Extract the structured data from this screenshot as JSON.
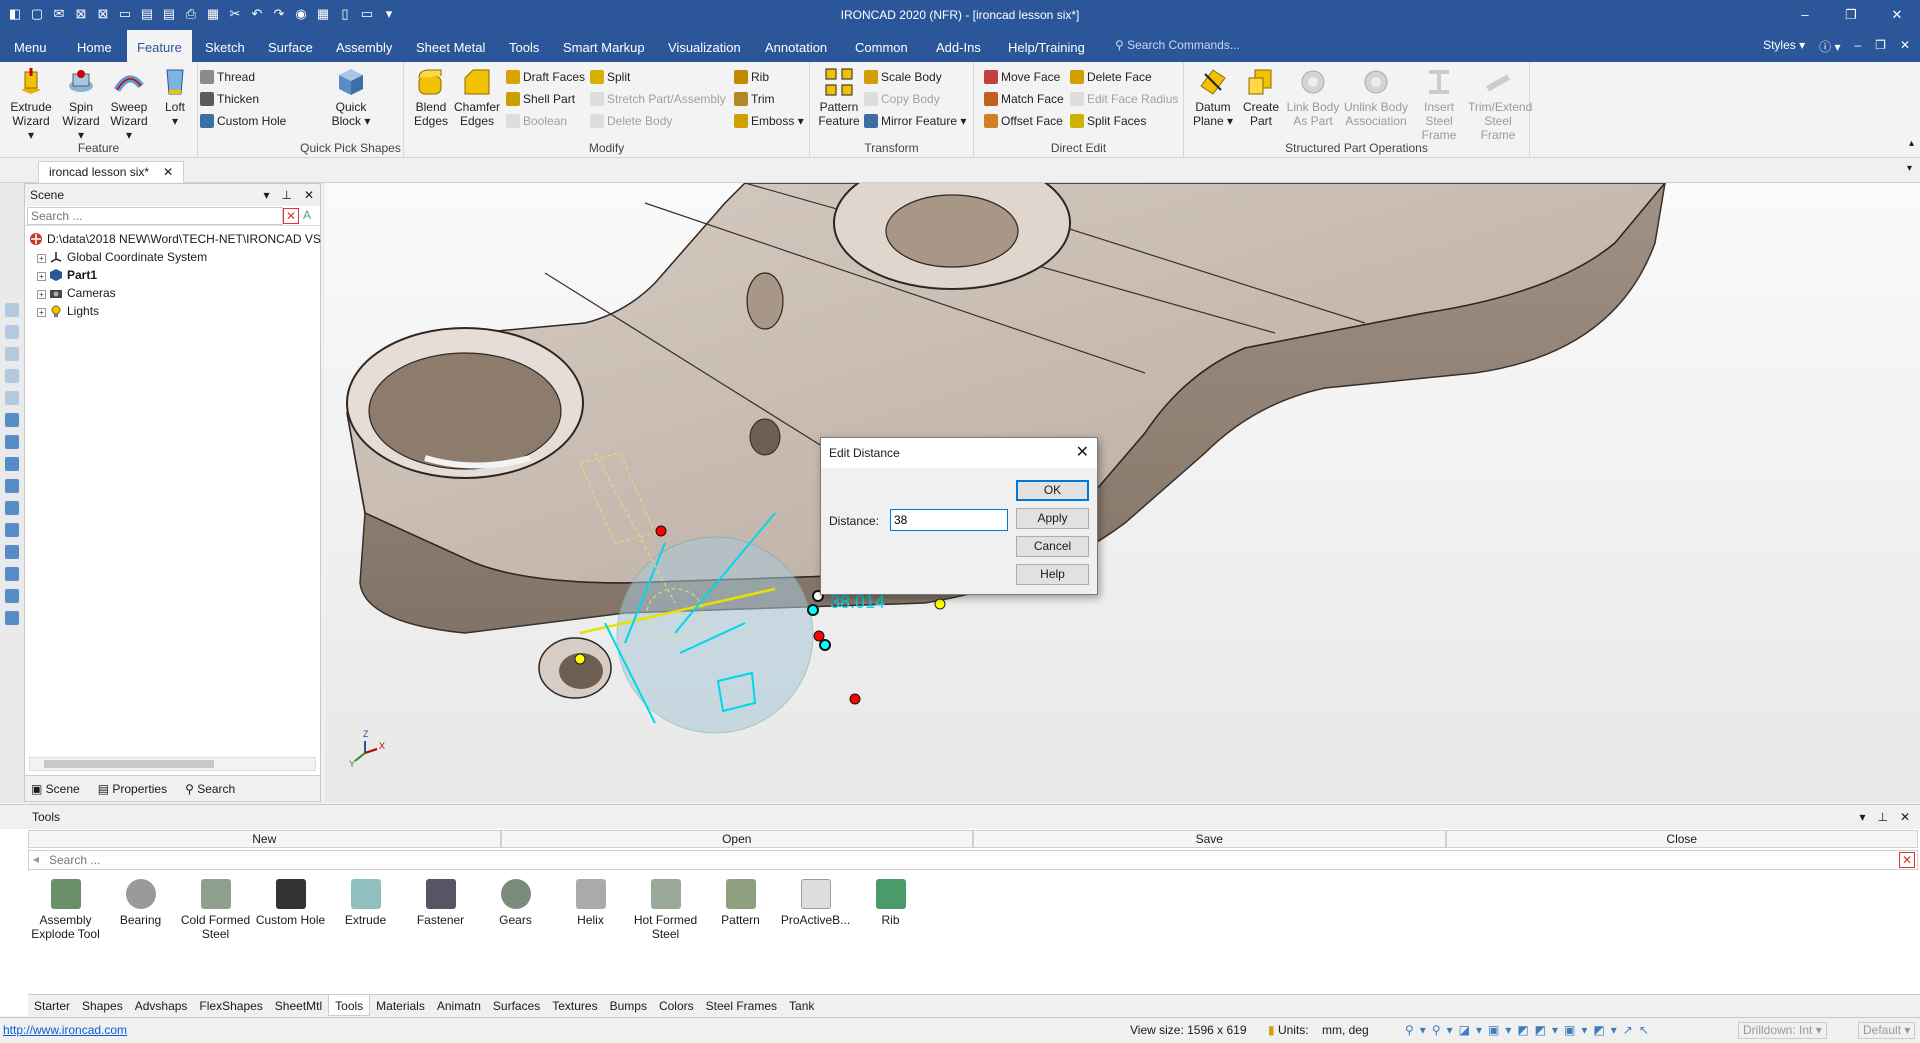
{
  "window": {
    "title": "IRONCAD 2020 (NFR) - [ironcad lesson six*]",
    "controls": [
      "–",
      "❐",
      "✕"
    ]
  },
  "ribbon_tabs": [
    "Menu",
    "Home",
    "Feature",
    "Sketch",
    "Surface",
    "Assembly",
    "Sheet Metal",
    "Tools",
    "Smart Markup",
    "Visualization",
    "Annotation",
    "Common",
    "Add-Ins",
    "Help/Training"
  ],
  "active_tab": "Feature",
  "search_commands_placeholder": "Search Commands...",
  "styles_label": "Styles",
  "ribbon": {
    "feature": {
      "label": "Feature",
      "extrude": "Extrude Wizard",
      "spin": "Spin Wizard",
      "sweep": "Sweep Wizard",
      "loft": "Loft",
      "thread": "Thread",
      "thicken": "Thicken",
      "custom_hole": "Custom Hole"
    },
    "quick_pick": {
      "label": "Quick Pick Shapes",
      "quick_block": "Quick Block"
    },
    "modify": {
      "label": "Modify",
      "blend": "Blend Edges",
      "chamfer": "Chamfer Edges",
      "draft_faces": "Draft Faces",
      "shell_part": "Shell Part",
      "boolean": "Boolean",
      "split": "Split",
      "stretch": "Stretch Part/Assembly",
      "delete_body": "Delete Body",
      "rib": "Rib",
      "trim": "Trim",
      "emboss": "Emboss"
    },
    "transform": {
      "label": "Transform",
      "pattern": "Pattern Feature",
      "scale_body": "Scale Body",
      "copy_body": "Copy Body",
      "mirror_feature": "Mirror Feature"
    },
    "direct_edit": {
      "label": "Direct Edit",
      "move_face": "Move Face",
      "match_face": "Match Face",
      "offset_face": "Offset Face",
      "delete_face": "Delete Face",
      "edit_face_radius": "Edit Face Radius",
      "split_faces": "Split Faces"
    },
    "structured": {
      "label": "Structured Part Operations",
      "datum_plane": "Datum Plane",
      "create_part": "Create Part",
      "link_body": "Link Body As Part",
      "unlink_body": "Unlink Body Association",
      "insert_steel": "Insert Steel Frame",
      "trim_extend": "Trim/Extend Steel Frame"
    }
  },
  "document_tab": "ironcad lesson six*",
  "scene_panel": {
    "title": "Scene",
    "search_placeholder": "Search ...",
    "root": "D:\\data\\2018 NEW\\Word\\TECH-NET\\IRONCAD VS",
    "nodes": [
      "Global Coordinate System",
      "Part1",
      "Cameras",
      "Lights"
    ],
    "bottom_tabs": [
      "Scene",
      "Properties",
      "Search"
    ]
  },
  "viewport": {
    "dimension_label": "38.014",
    "triad": {
      "x": "X",
      "y": "Y",
      "z": "Z"
    }
  },
  "dialog": {
    "title": "Edit Distance",
    "field_label": "Distance:",
    "field_value": "38",
    "buttons": [
      "OK",
      "Apply",
      "Cancel",
      "Help"
    ]
  },
  "tools_panel": {
    "title": "Tools",
    "actions": [
      "New",
      "Open",
      "Save",
      "Close"
    ],
    "search_placeholder": "Search ...",
    "items": [
      "Assembly Explode Tool",
      "Bearing",
      "Cold Formed Steel",
      "Custom Hole",
      "Extrude",
      "Fastener",
      "Gears",
      "Helix",
      "Hot Formed Steel",
      "Pattern",
      "ProActiveB...",
      "Rib"
    ],
    "catalog_tabs": [
      "Starter",
      "Shapes",
      "Advshaps",
      "FlexShapes",
      "SheetMtl",
      "Tools",
      "Materials",
      "Animatn",
      "Surfaces",
      "Textures",
      "Bumps",
      "Colors",
      "Steel Frames",
      "Tank"
    ],
    "active_catalog": "Tools"
  },
  "status": {
    "url": "http://www.ironcad.com",
    "view_size": "View size: 1596 x  619",
    "units_label": "Units:",
    "units_value": "mm, deg",
    "drilldown": "Drilldown: Int",
    "default": "Default"
  }
}
